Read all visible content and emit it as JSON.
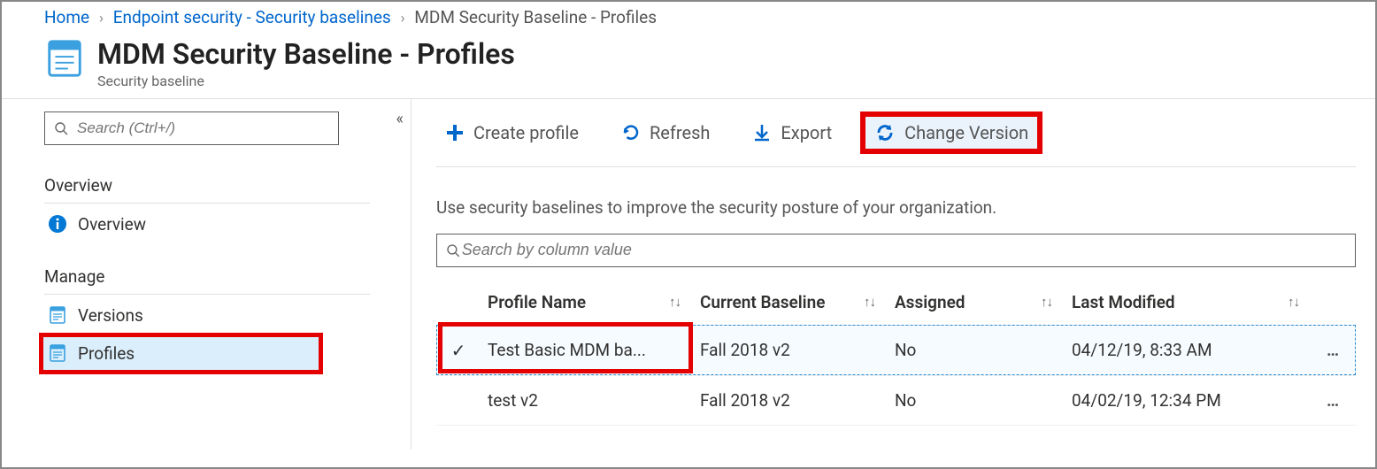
{
  "breadcrumb": {
    "home": "Home",
    "endpoint": "Endpoint security - Security baselines",
    "current": "MDM Security Baseline - Profiles"
  },
  "header": {
    "title": "MDM Security Baseline - Profiles",
    "subtitle": "Security baseline"
  },
  "sidebar": {
    "search_placeholder": "Search (Ctrl+/)",
    "section_overview": "Overview",
    "item_overview": "Overview",
    "section_manage": "Manage",
    "item_versions": "Versions",
    "item_profiles": "Profiles"
  },
  "toolbar": {
    "create": "Create profile",
    "refresh": "Refresh",
    "export": "Export",
    "change_version": "Change Version"
  },
  "content": {
    "description": "Use security baselines to improve the security posture of your organization.",
    "col_search_placeholder": "Search by column value"
  },
  "table": {
    "h_profile": "Profile Name",
    "h_baseline": "Current Baseline",
    "h_assigned": "Assigned",
    "h_modified": "Last Modified",
    "rows": [
      {
        "name": "Test Basic MDM ba...",
        "baseline": "Fall 2018 v2",
        "assigned": "No",
        "modified": "04/12/19, 8:33 AM"
      },
      {
        "name": "test v2",
        "baseline": "Fall 2018 v2",
        "assigned": "No",
        "modified": "04/02/19, 12:34 PM"
      }
    ]
  }
}
